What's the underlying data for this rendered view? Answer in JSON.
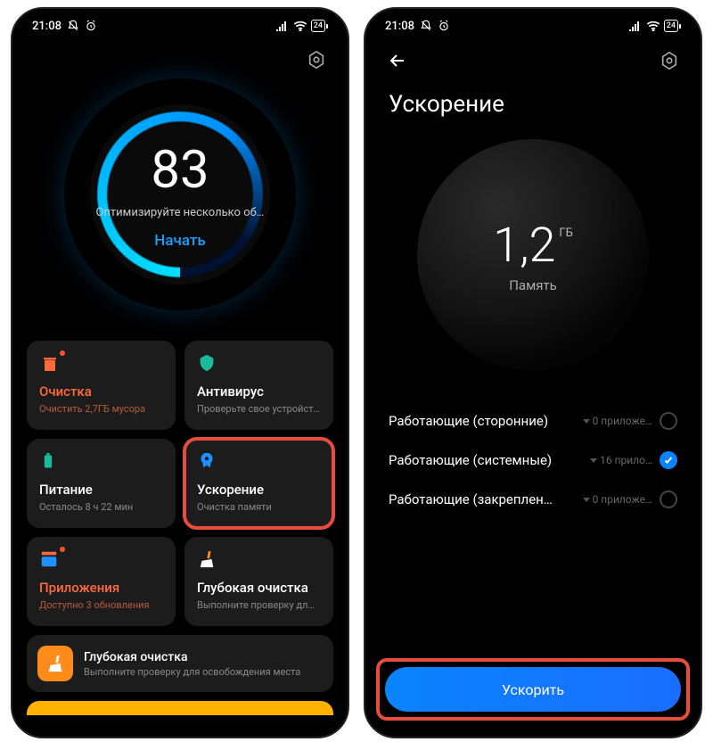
{
  "status": {
    "time": "21:08",
    "battery": "24"
  },
  "screen1": {
    "score": "83",
    "subtitle": "Оптимизируйте несколько об…",
    "start": "Начать",
    "cards": {
      "clean": {
        "title": "Очистка",
        "sub": "Очистить 2,7ГБ мусора"
      },
      "antivirus": {
        "title": "Антивирус",
        "sub": "Проверьте свое устройст…"
      },
      "power": {
        "title": "Питание",
        "sub": "Осталось 8 ч 22 мин"
      },
      "boost": {
        "title": "Ускорение",
        "sub": "Очистка памяти"
      },
      "apps": {
        "title": "Приложения",
        "sub": "Доступно 3 обновления"
      },
      "deep": {
        "title": "Глубокая очистка",
        "sub": "Выполните проверку дл…"
      }
    },
    "deepRow": {
      "title": "Глубокая очистка",
      "sub": "Выполните проверку для освобождения места"
    }
  },
  "screen2": {
    "title": "Ускорение",
    "memValue": "1,2",
    "memUnit": "ГБ",
    "memLabel": "Память",
    "rows": {
      "third": {
        "label": "Работающие (сторонние)",
        "count": "0 приложе…"
      },
      "system": {
        "label": "Работающие (системные)",
        "count": "16 прило…"
      },
      "pinned": {
        "label": "Работающие (закреплен…",
        "count": "0 приложе…"
      }
    },
    "button": "Ускорить"
  }
}
